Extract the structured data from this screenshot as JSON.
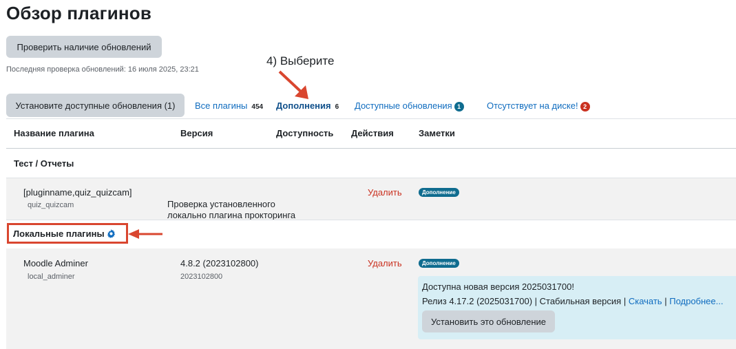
{
  "header": {
    "title": "Обзор плагинов"
  },
  "check_button": "Проверить наличие обновлений",
  "last_check": "Последняя проверка обновлений: 16 июля 2025, 23:21",
  "annotation_step": "4) Выберите",
  "annotation_note": "Проверка установленного локально плагина прокторинга",
  "install_all_button": "Установите доступные обновления (1)",
  "tabs": [
    {
      "label": "Все плагины",
      "count": "454"
    },
    {
      "label": "Дополнения",
      "count": "6"
    },
    {
      "label": "Доступные обновления",
      "count": "1"
    },
    {
      "label": "Отсутствует на диске!",
      "count": "2"
    }
  ],
  "columns": [
    "Название плагина",
    "Версия",
    "Доступность",
    "Действия",
    "Заметки"
  ],
  "group1": {
    "title": "Тест / Отчеты"
  },
  "plugin1": {
    "name": "[pluginname,quiz_quizcam]",
    "id": "quiz_quizcam",
    "action": "Удалить",
    "badge": "Дополнение"
  },
  "group2": {
    "title": "Локальные плагины"
  },
  "plugin2": {
    "name": "Moodle Adminer",
    "id": "local_adminer",
    "version": "4.8.2 (2023102800)",
    "build": "2023102800",
    "action": "Удалить",
    "badge": "Дополнение",
    "update_title": "Доступна новая версия 2025031700!",
    "release_text": "Релиз 4.17.2 (2025031700) | Стабильная версия |",
    "download_link": "Скачать",
    "sep": "|",
    "more_link": "Подробнее...",
    "install_button": "Установить это обновление"
  },
  "colors": {
    "link": "#0f6cbf",
    "danger": "#ca3120",
    "badge": "#0f6c8f",
    "annotation": "#d9462f",
    "update_bg": "#d7eef5"
  }
}
